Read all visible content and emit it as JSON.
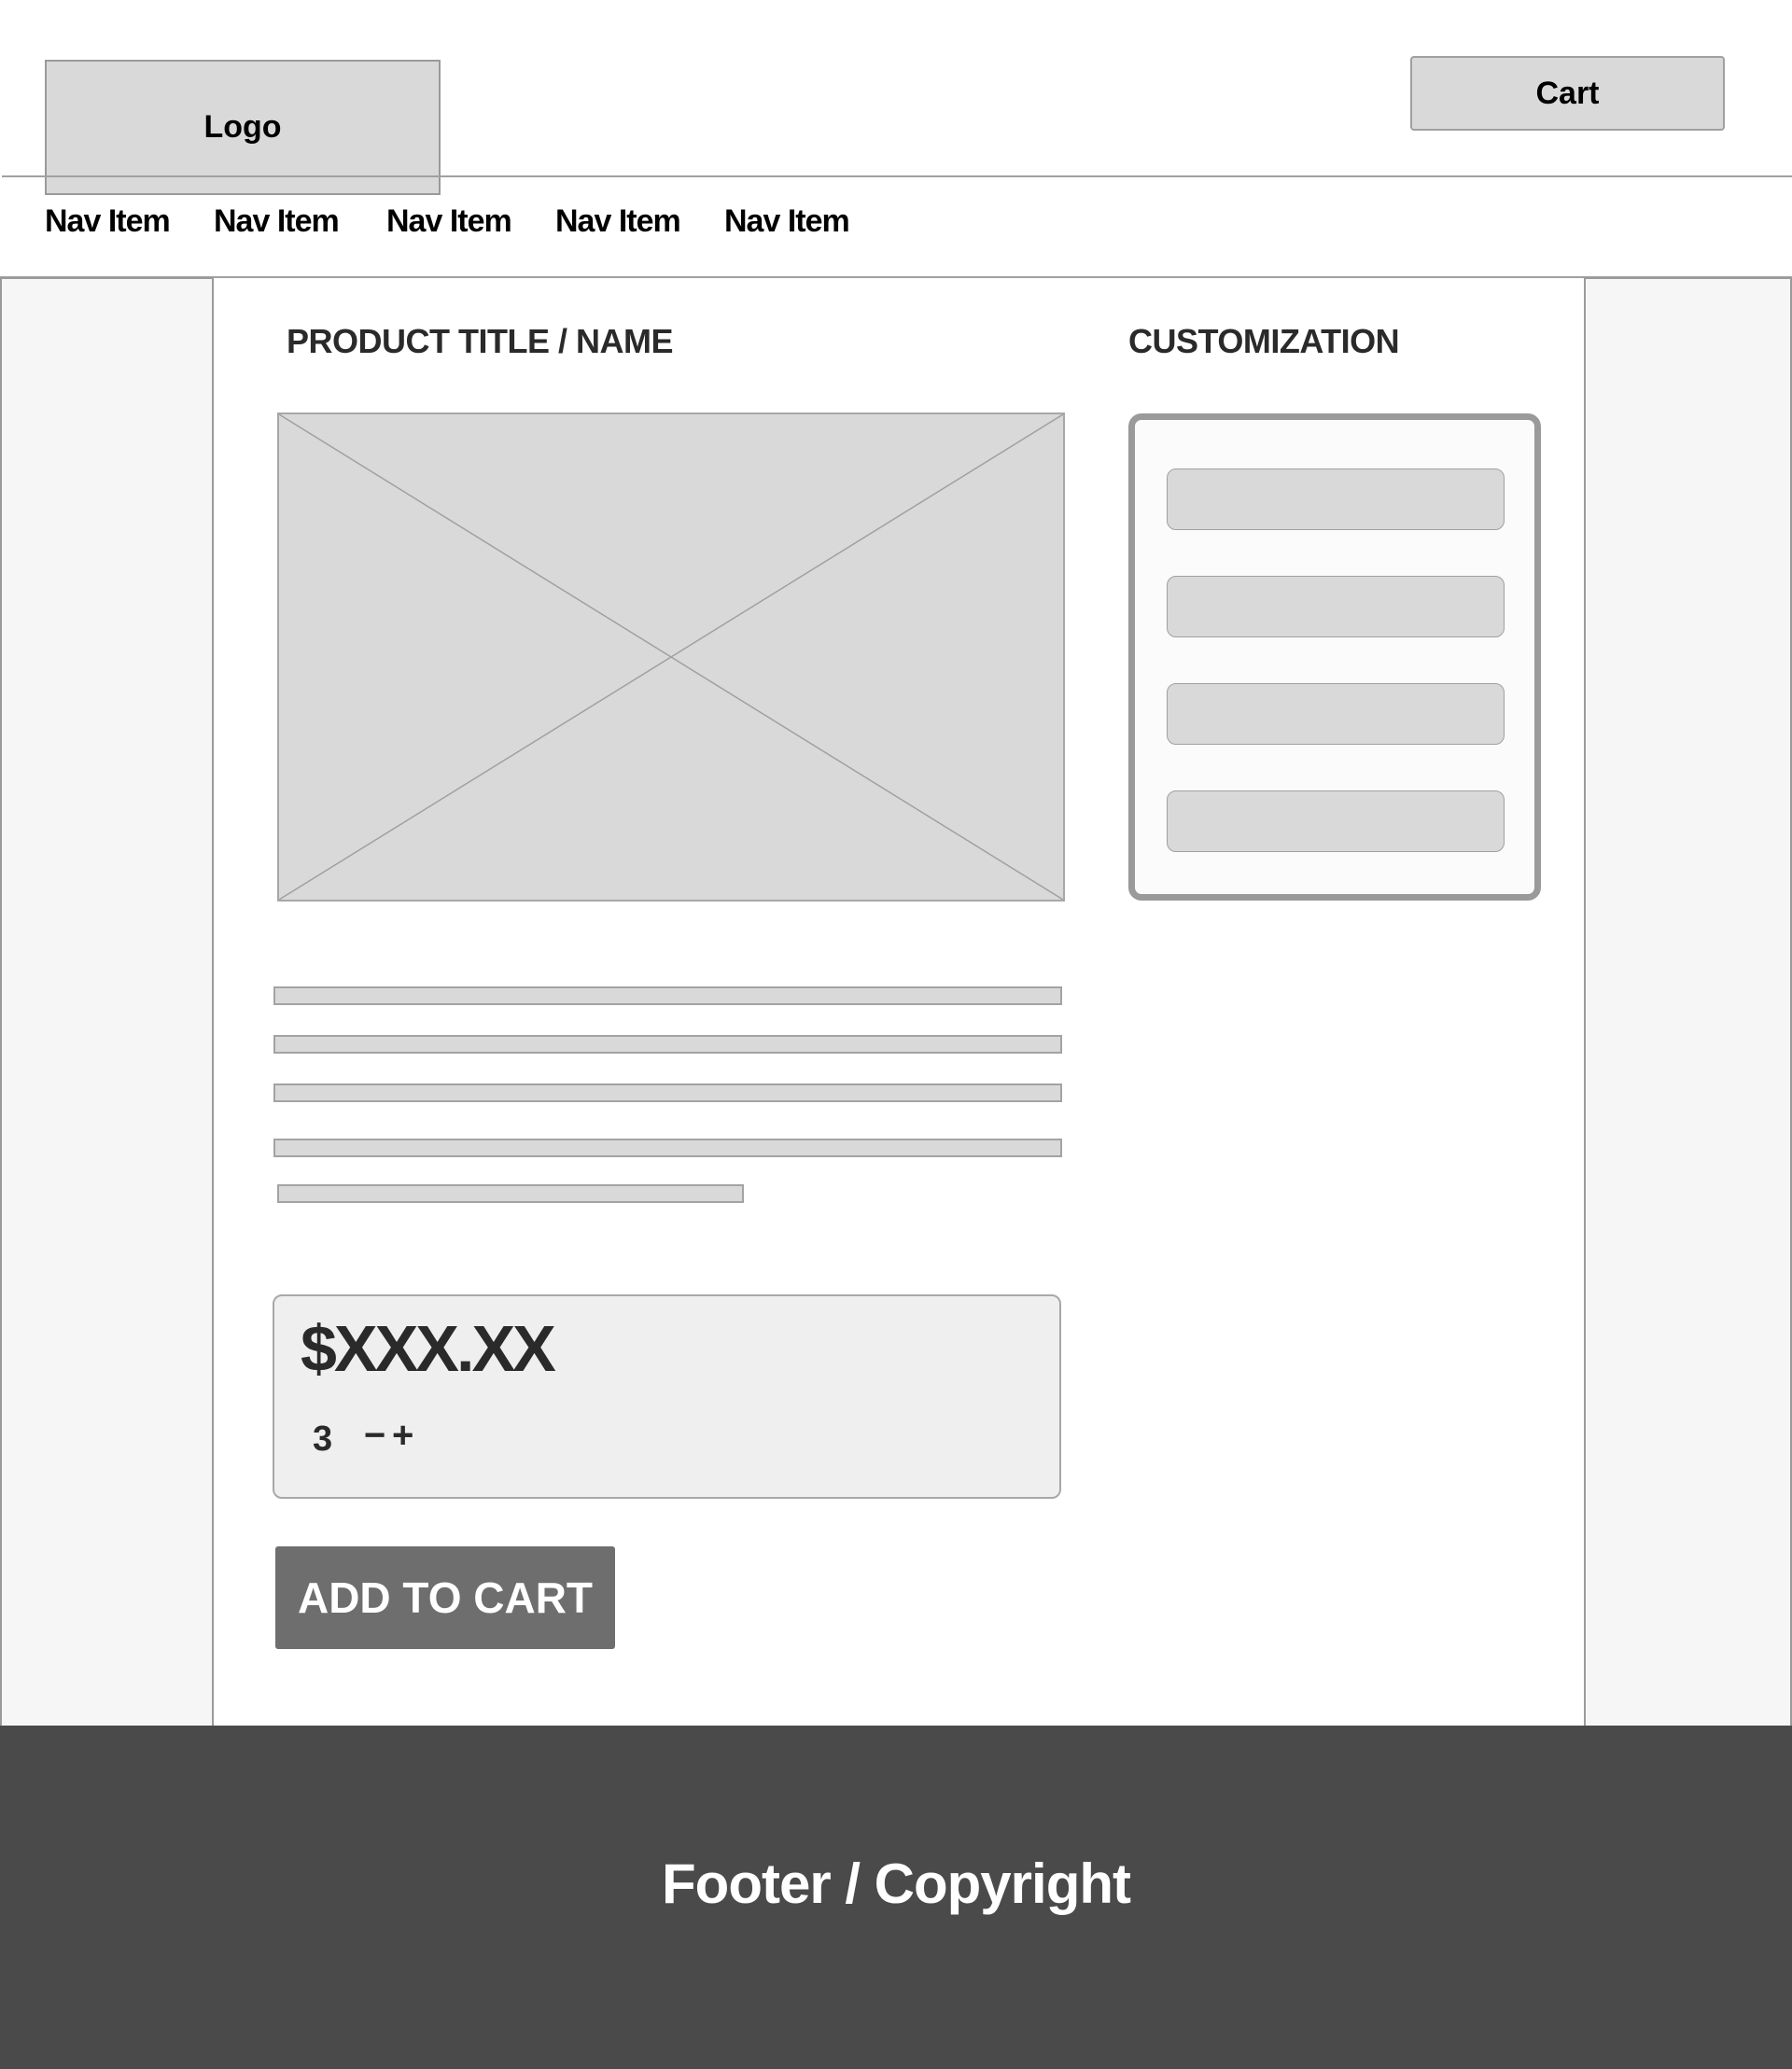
{
  "header": {
    "logo_label": "Logo",
    "cart_label": "Cart"
  },
  "nav": {
    "items": [
      {
        "label": "Nav Item"
      },
      {
        "label": "Nav Item"
      },
      {
        "label": "Nav Item"
      },
      {
        "label": "Nav Item"
      },
      {
        "label": "Nav Item"
      }
    ]
  },
  "product": {
    "title": "PRODUCT TITLE / NAME",
    "image_icon": "image-placeholder-icon",
    "description_lines": 5,
    "price": "$XXX.XX",
    "quantity": "3",
    "decrement_label": "−",
    "increment_label": "+",
    "add_to_cart_label": "ADD TO CART"
  },
  "customization": {
    "title": "CUSTOMIZATION",
    "options": [
      {
        "label": ""
      },
      {
        "label": ""
      },
      {
        "label": ""
      },
      {
        "label": ""
      }
    ]
  },
  "footer": {
    "text": "Footer / Copyright"
  },
  "colors": {
    "placeholder_fill": "#d9d9d9",
    "border": "#9a9a9a",
    "button": "#6e6e6e",
    "footer_bg": "#4a4a4a",
    "side_bg": "#f6f6f6"
  }
}
